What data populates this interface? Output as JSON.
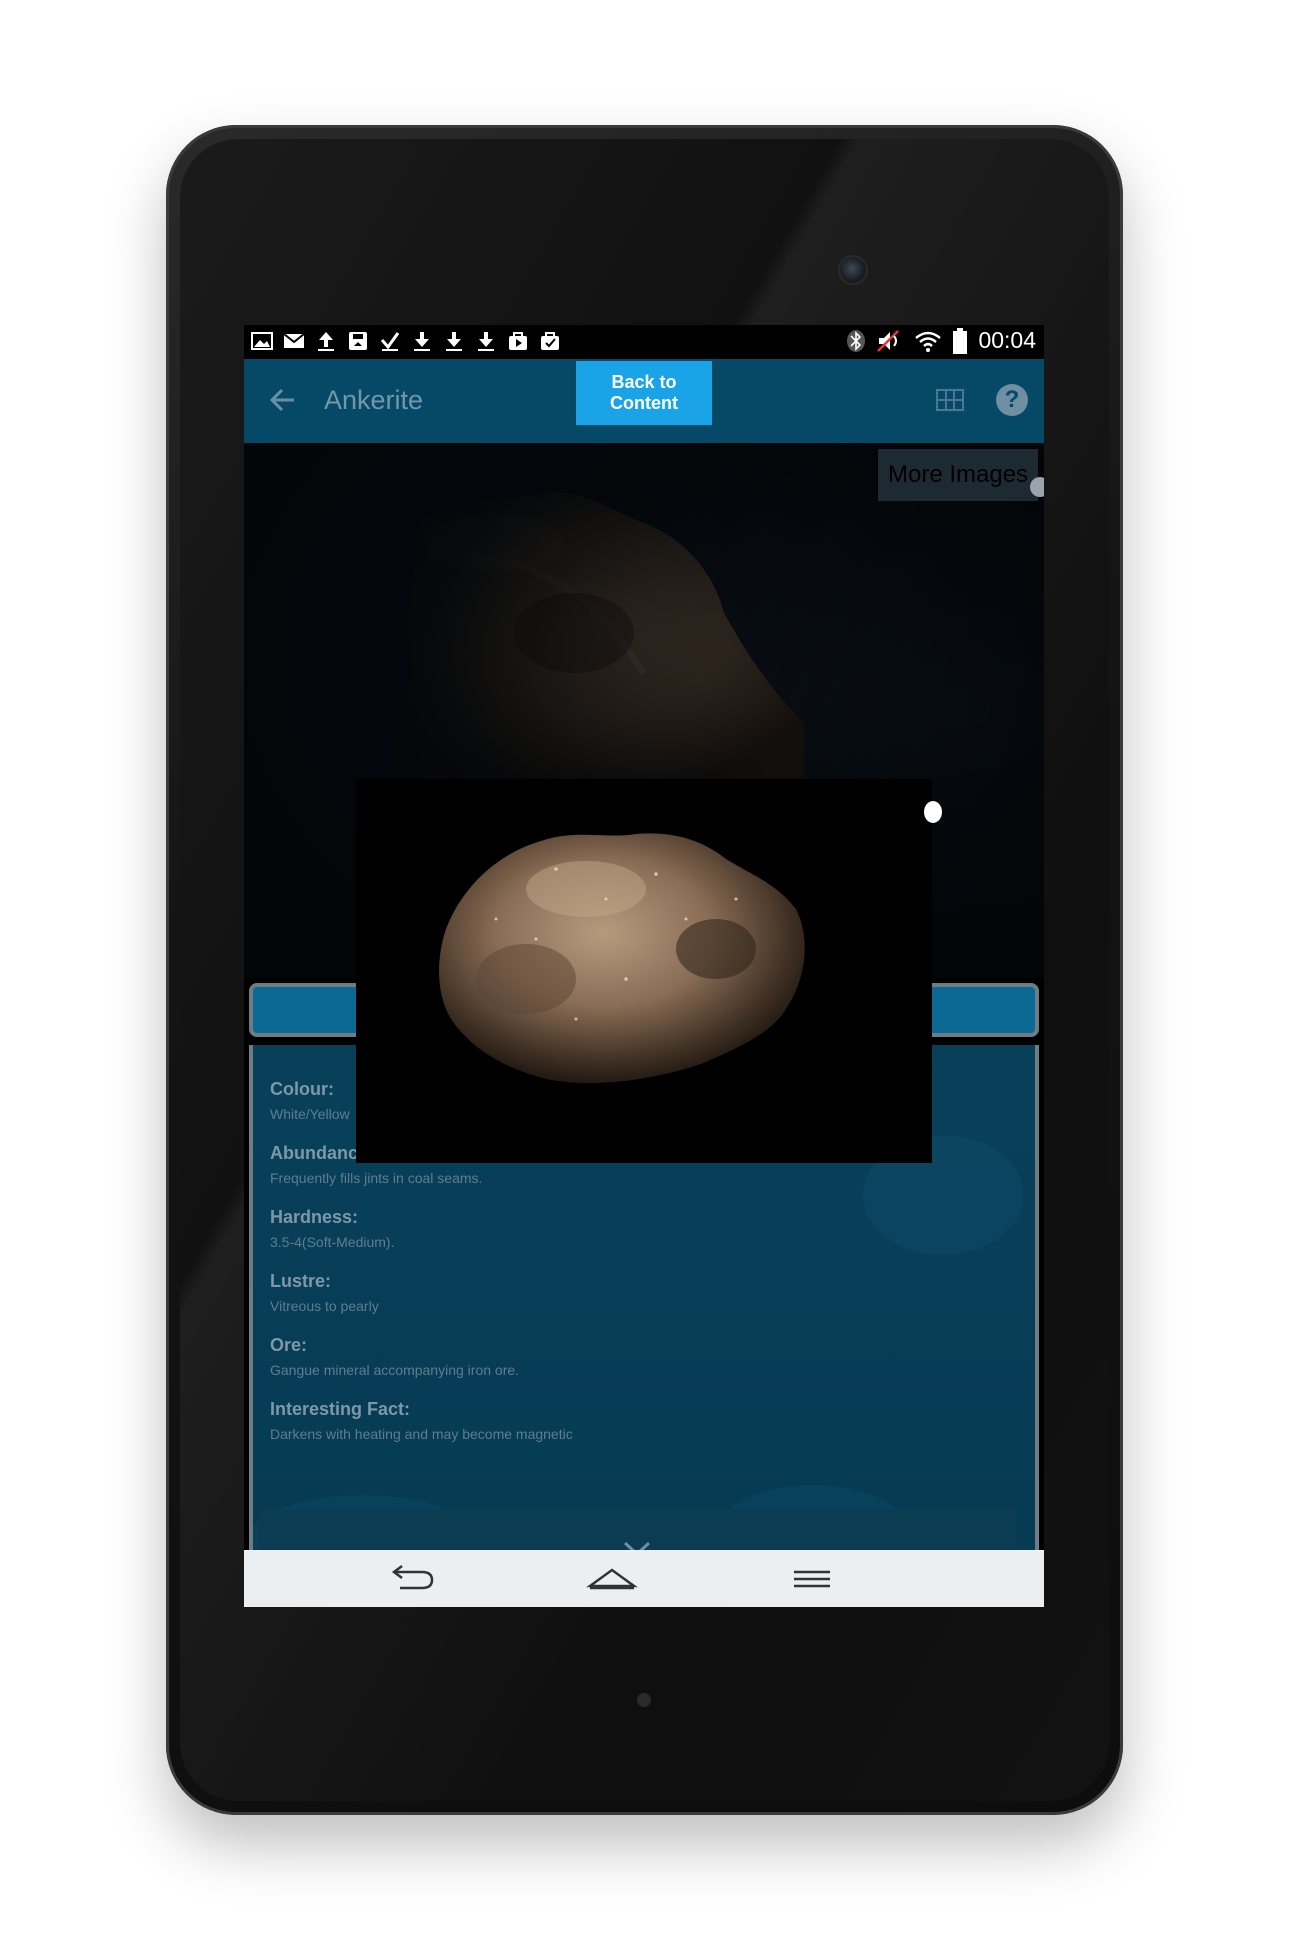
{
  "status_bar": {
    "left_icons": [
      "image-icon",
      "mail-icon",
      "upload-icon",
      "save-icon",
      "check-icon",
      "download-icon",
      "download-icon",
      "download-icon",
      "video-store-icon",
      "bag-check-icon"
    ],
    "right_icons": [
      "bluetooth-icon",
      "volume-muted-icon",
      "wifi-icon",
      "battery-icon"
    ],
    "time": "00:04"
  },
  "app_bar": {
    "title": "Ankerite",
    "back_to_content_label": "Back to Content",
    "accent_color": "#054966",
    "button_color": "#1aa3e6"
  },
  "gallery": {
    "more_images_label": "More Images"
  },
  "properties": [
    {
      "label": "Colour:",
      "value": "White/Yellow"
    },
    {
      "label": "Abundance:",
      "value": "Frequently fills jints in coal seams."
    },
    {
      "label": "Hardness:",
      "value": "3.5-4(Soft-Medium)."
    },
    {
      "label": "Lustre:",
      "value": "Vitreous to pearly"
    },
    {
      "label": "Ore:",
      "value": "Gangue mineral accompanying iron ore."
    },
    {
      "label": "Interesting Fact:",
      "value": "Darkens with heating and may become magnetic"
    }
  ],
  "nav_bar": {
    "buttons": [
      "back-nav-icon",
      "home-nav-icon",
      "menu-nav-icon"
    ]
  }
}
